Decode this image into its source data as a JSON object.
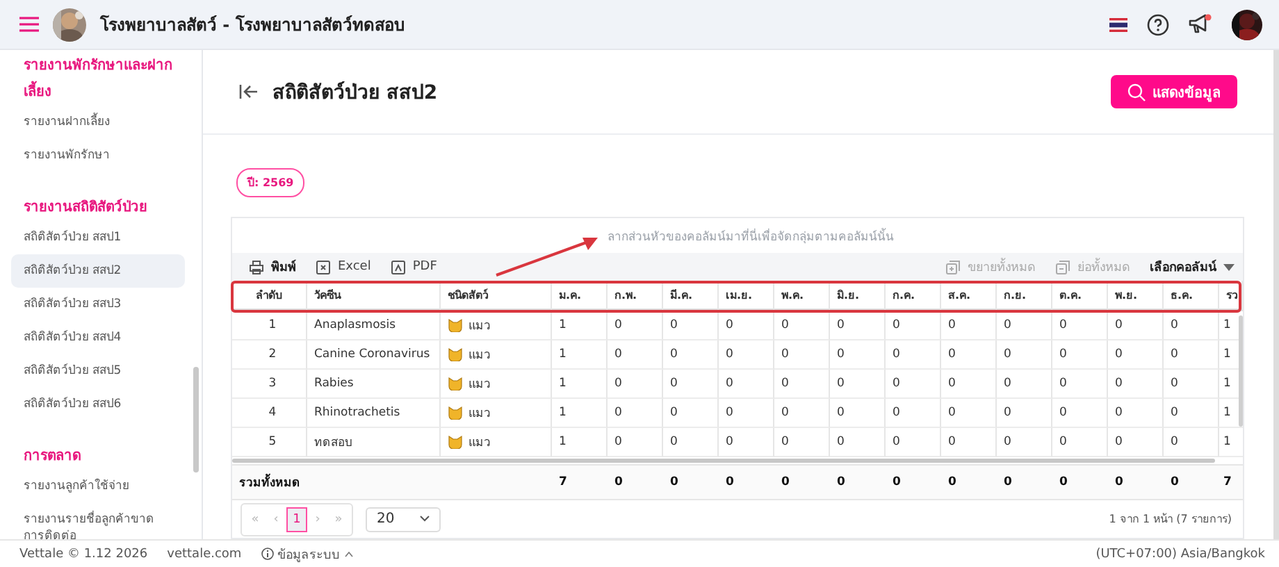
{
  "header": {
    "title": "โรงพยาบาลสัตว์ - โรงพยาบาลสัตว์ทดสอบ",
    "notification_dot": true
  },
  "sidebar": {
    "sections": [
      {
        "heading": "รายงานพักรักษาและฝากเลี้ยง",
        "items": [
          {
            "label": "รายงานฝากเลี้ยง",
            "selected": false
          },
          {
            "label": "รายงานพักรักษา",
            "selected": false
          }
        ]
      },
      {
        "heading": "รายงานสถิติสัตว์ป่วย",
        "items": [
          {
            "label": "สถิติสัตว์ป่วย สสป1",
            "selected": false
          },
          {
            "label": "สถิติสัตว์ป่วย สสป2",
            "selected": true
          },
          {
            "label": "สถิติสัตว์ป่วย สสป3",
            "selected": false
          },
          {
            "label": "สถิติสัตว์ป่วย สสป4",
            "selected": false
          },
          {
            "label": "สถิติสัตว์ป่วย สสป5",
            "selected": false
          },
          {
            "label": "สถิติสัตว์ป่วย สสป6",
            "selected": false
          }
        ]
      },
      {
        "heading": "การตลาด",
        "items": [
          {
            "label": "รายงานลูกค้าใช้จ่าย",
            "selected": false
          },
          {
            "label": "รายงานรายชื่อลูกค้าขาดการติดต่อ",
            "selected": false
          }
        ]
      }
    ]
  },
  "page": {
    "title": "สถิติสัตว์ป่วย สสป2",
    "show_button": "แสดงข้อมูล",
    "year_chip": "ปี: 2569"
  },
  "grid": {
    "group_hint": "ลากส่วนหัวของคอลัมน์มาที่นี่เพื่อจัดกลุ่มตามคอลัมน์นั้น",
    "toolbar_left": [
      {
        "kind": "print",
        "label": "พิมพ์",
        "disabled": false
      },
      {
        "kind": "excel",
        "label": "Excel",
        "disabled": false
      },
      {
        "kind": "pdf",
        "label": "PDF",
        "disabled": false
      }
    ],
    "toolbar_right": [
      {
        "kind": "expand",
        "label": "ขยายทั้งหมด",
        "disabled": true
      },
      {
        "kind": "collapse",
        "label": "ย่อทั้งหมด",
        "disabled": true
      },
      {
        "kind": "columns",
        "label": "เลือกคอลัมน์",
        "disabled": false
      }
    ],
    "columns": [
      "ลำดับ",
      "วัคซีน",
      "ชนิดสัตว์",
      "ม.ค.",
      "ก.พ.",
      "มี.ค.",
      "เม.ย.",
      "พ.ค.",
      "มิ.ย.",
      "ก.ค.",
      "ส.ค.",
      "ก.ย.",
      "ต.ค.",
      "พ.ย.",
      "ธ.ค.",
      "รว"
    ],
    "rows": [
      {
        "no": "1",
        "vaccine": "Anaplasmosis",
        "species": "แมว",
        "values": [
          "1",
          "0",
          "0",
          "0",
          "0",
          "0",
          "0",
          "0",
          "0",
          "0",
          "0",
          "0",
          "1"
        ]
      },
      {
        "no": "2",
        "vaccine": "Canine Coronavirus",
        "species": "แมว",
        "values": [
          "1",
          "0",
          "0",
          "0",
          "0",
          "0",
          "0",
          "0",
          "0",
          "0",
          "0",
          "0",
          "1"
        ]
      },
      {
        "no": "3",
        "vaccine": "Rabies",
        "species": "แมว",
        "values": [
          "1",
          "0",
          "0",
          "0",
          "0",
          "0",
          "0",
          "0",
          "0",
          "0",
          "0",
          "0",
          "1"
        ]
      },
      {
        "no": "4",
        "vaccine": "Rhinotrachetis",
        "species": "แมว",
        "values": [
          "1",
          "0",
          "0",
          "0",
          "0",
          "0",
          "0",
          "0",
          "0",
          "0",
          "0",
          "0",
          "1"
        ]
      },
      {
        "no": "5",
        "vaccine": "ทดสอบ",
        "species": "แมว",
        "values": [
          "1",
          "0",
          "0",
          "0",
          "0",
          "0",
          "0",
          "0",
          "0",
          "0",
          "0",
          "0",
          "1"
        ]
      }
    ],
    "totals": {
      "label": "รวมทั้งหมด",
      "values": [
        "7",
        "0",
        "0",
        "0",
        "0",
        "0",
        "0",
        "0",
        "0",
        "0",
        "0",
        "0",
        "7"
      ]
    },
    "pager": {
      "first": "«",
      "prev": "‹",
      "pages": [
        {
          "label": "1",
          "selected": true
        }
      ],
      "next": "›",
      "last": "»",
      "page_size": "20",
      "info": "1 จาก 1 หน้า (7 รายการ)"
    }
  },
  "footer": {
    "version": "Vettale © 1.12 2026",
    "site": "vettale.com",
    "system_info": "ข้อมูลระบบ",
    "timezone": "(UTC+07:00) Asia/Bangkok"
  }
}
